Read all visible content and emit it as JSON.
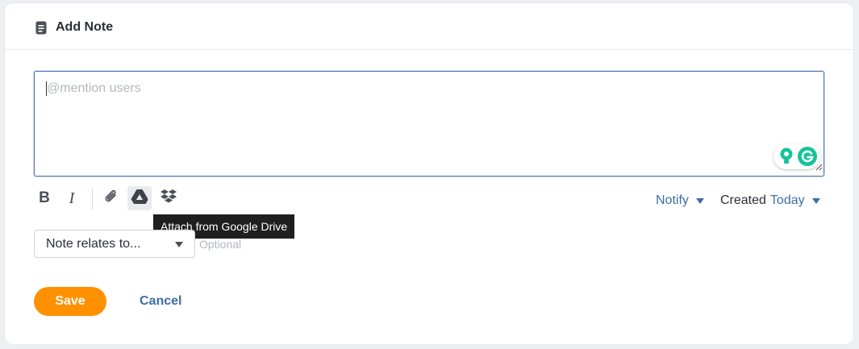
{
  "header": {
    "title": "Add Note",
    "icon": "note-icon"
  },
  "editor": {
    "placeholder": "@mention users",
    "value": "",
    "grammarly_icons": [
      "bulb-icon",
      "grammarly-g-icon"
    ]
  },
  "toolbar": {
    "bold_label": "B",
    "italic_label": "I",
    "icons": [
      "paperclip-icon",
      "google-drive-icon",
      "dropbox-icon"
    ],
    "tooltip": "Attach from Google Drive",
    "notify_label": "Notify",
    "created_label": "Created",
    "created_value": "Today"
  },
  "relates": {
    "selected": "Note relates to...",
    "hint": "Optional"
  },
  "actions": {
    "save_label": "Save",
    "cancel_label": "Cancel"
  },
  "colors": {
    "accent": "#ff9000",
    "link": "#3b6ea8",
    "focus_border": "#4f74b3",
    "grammarly": "#15c39a"
  }
}
